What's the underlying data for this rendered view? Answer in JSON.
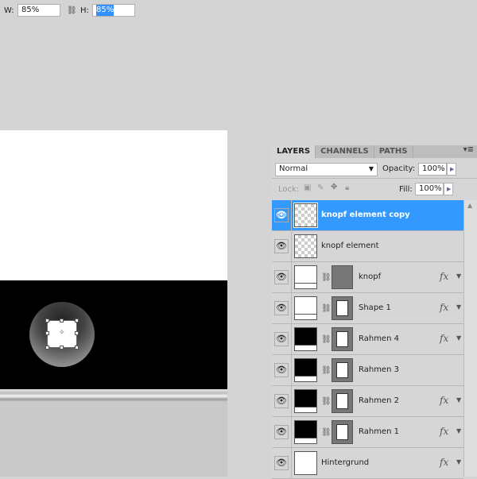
{
  "options_bar": {
    "w_label": "W:",
    "w_value": "85%",
    "h_label": "H:",
    "h_value": "85%"
  },
  "panel": {
    "tabs": [
      "LAYERS",
      "CHANNELS",
      "PATHS"
    ],
    "blend_mode": "Normal",
    "opacity_label": "Opacity:",
    "opacity_value": "100%",
    "lock_label": "Lock:",
    "fill_label": "Fill:",
    "fill_value": "100%",
    "layers": [
      {
        "name": "knopf element copy",
        "thumb": "transparent",
        "selected": true,
        "fx": false,
        "mask": false
      },
      {
        "name": "knopf element",
        "thumb": "transparent",
        "selected": false,
        "fx": false,
        "mask": false
      },
      {
        "name": "knopf",
        "thumb": "white",
        "selected": false,
        "fx": true,
        "mask": "gray"
      },
      {
        "name": "Shape 1",
        "thumb": "white",
        "selected": false,
        "fx": true,
        "mask": "frame"
      },
      {
        "name": "Rahmen 4",
        "thumb": "black",
        "selected": false,
        "fx": true,
        "mask": "frame"
      },
      {
        "name": "Rahmen 3",
        "thumb": "black",
        "selected": false,
        "fx": false,
        "mask": "frame"
      },
      {
        "name": "Rahmen 2",
        "thumb": "black",
        "selected": false,
        "fx": true,
        "mask": "frame"
      },
      {
        "name": "Rahmen 1",
        "thumb": "black",
        "selected": false,
        "fx": true,
        "mask": "frame"
      },
      {
        "name": "Hintergrund",
        "thumb": "white-plain",
        "selected": false,
        "fx": true,
        "mask": false
      }
    ],
    "fx_label": "fx"
  },
  "colors": {
    "selection": "#3399ff"
  }
}
